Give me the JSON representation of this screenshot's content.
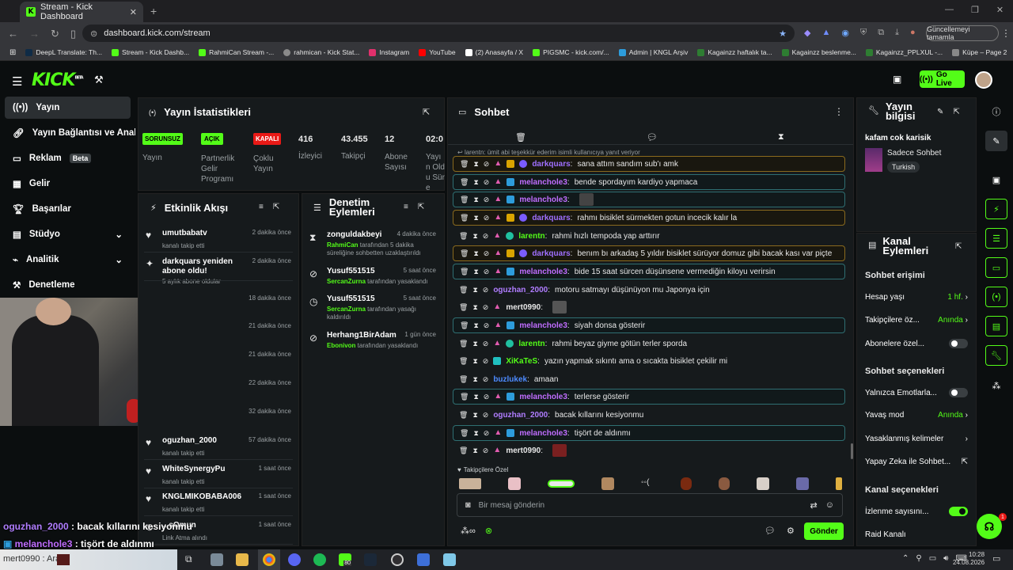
{
  "browser": {
    "tab_title": "Stream - Kick Dashboard",
    "url": "dashboard.kick.com/stream",
    "update_label": "Güncellemeyi tamamla",
    "bookmarks": [
      {
        "label": "DeepL Translate: Th...",
        "color": "#0f2b46"
      },
      {
        "label": "Stream - Kick Dashb...",
        "color": "#53fc18"
      },
      {
        "label": "RahmiCan Stream -...",
        "color": "#53fc18"
      },
      {
        "label": "rahmican - Kick Stat...",
        "color": "#8a8a8a"
      },
      {
        "label": "Instagram",
        "color": "#e1306c"
      },
      {
        "label": "YouTube",
        "color": "#ff0000"
      },
      {
        "label": "(2) Anasayfa / X",
        "color": "#ffffff"
      },
      {
        "label": "PIGSMC - kick.com/...",
        "color": "#53fc18"
      },
      {
        "label": "Admin | KNGL Arşiv",
        "color": "#2d9cdb"
      },
      {
        "label": "Kagainzz haftalık ta...",
        "color": "#2e7d32"
      },
      {
        "label": "Kagainzz beslenme...",
        "color": "#2e7d32"
      },
      {
        "label": "Kagainzz_PPLXUL -...",
        "color": "#2e7d32"
      },
      {
        "label": "Küpe – Page 2",
        "color": "#888888"
      }
    ]
  },
  "header": {
    "logo": "KICK",
    "logo_sup": "BETA",
    "go_live": "Go Live"
  },
  "sidebar": {
    "items": [
      {
        "label": "Yayın",
        "icon": "broadcast-icon"
      },
      {
        "label": "Yayın Bağlantısı ve Anahtarı",
        "icon": "link-icon"
      },
      {
        "label": "Reklam",
        "icon": "ad-icon",
        "badge": "Beta"
      },
      {
        "label": "Gelir",
        "icon": "wallet-icon"
      },
      {
        "label": "Başarılar",
        "icon": "trophy-icon"
      },
      {
        "label": "Stüdyo",
        "icon": "studio-icon"
      },
      {
        "label": "Analitik",
        "icon": "analytics-icon"
      },
      {
        "label": "Denetleme",
        "icon": "hammer-icon"
      }
    ]
  },
  "stats": {
    "title": "Yayın İstatistikleri",
    "badges": [
      {
        "value": "SORUNSUZ",
        "label": "Yayın",
        "color": "#53fc18"
      },
      {
        "value": "AÇIK",
        "label": "Partnerlik Gelir Programı",
        "color": "#53fc18"
      },
      {
        "value": "KAPALI",
        "label": "Çoklu Yayın",
        "color": "#e91916"
      }
    ],
    "numbers": [
      {
        "value": "416",
        "label": "İzleyici"
      },
      {
        "value": "43.455",
        "label": "Takipçi"
      },
      {
        "value": "12",
        "label": "Abone Sayısı"
      },
      {
        "value": "02:0",
        "label": "Yayın Oldu Süre"
      }
    ]
  },
  "activity": {
    "title": "Etkinlik Akışı",
    "items": [
      {
        "name": "umutbabatv",
        "sub": "kanalı takip etti",
        "time": "2 dakika önce"
      },
      {
        "name": "darkquars yeniden abone oldu!",
        "sub": "5 aylık abone oldular",
        "time": "2 dakika önce"
      },
      {
        "name": "",
        "sub": "",
        "time": "18 dakika önce"
      },
      {
        "name": "",
        "sub": "",
        "time": "21 dakika önce"
      },
      {
        "name": "",
        "sub": "",
        "time": "21 dakika önce"
      },
      {
        "name": "",
        "sub": "",
        "time": "22 dakika önce"
      },
      {
        "name": "",
        "sub": "",
        "time": "32 dakika önce"
      },
      {
        "name": "oguzhan_2000",
        "sub": "kanalı takip etti",
        "time": "57 dakika önce"
      },
      {
        "name": "WhiteSynergyPu",
        "sub": "kanalı takip etti",
        "time": "1 saat önce"
      },
      {
        "name": "KNGLMIKOBABA006",
        "sub": "kanalı takip etti",
        "time": "1 saat önce"
      },
      {
        "name": "...sOmun",
        "sub": "Link Atma alındı",
        "time": "1 saat önce"
      }
    ]
  },
  "moderation": {
    "title": "Denetim Eylemleri",
    "items": [
      {
        "name": "zonguldakbeyi",
        "actor": "RahmiCan",
        "rest": " tarafından 5 dakika süreliğine sohbetten uzaklaştırıldı",
        "time": "4 dakika önce"
      },
      {
        "name": "Yusuf551515",
        "actor": "SercanZurna",
        "rest": " tarafından yasaklandı",
        "time": "5 saat önce"
      },
      {
        "name": "Yusuf551515",
        "actor": "SercanZurna",
        "rest": " tarafından yasağı kaldırıldı",
        "time": "5 saat önce"
      },
      {
        "name": "Herhang1BirAdam",
        "actor": "Ebonivon",
        "rest": " tarafından yasaklandı",
        "time": "1 gün önce"
      }
    ]
  },
  "chat": {
    "title": "Sohbet",
    "reply_note": "larentn: ümit abi teşekkür ederim isimli kullanıcıya yanıt veriyor",
    "messages": [
      {
        "user": "darkquars",
        "text": "sana attım sandım sub'ı amk",
        "color": "#a070ff",
        "style": "hlg"
      },
      {
        "user": "melanchole3",
        "text": "bende spordayım kardiyo yapmaca",
        "color": "#c06dff",
        "style": "hl"
      },
      {
        "user": "melanchole3",
        "text": "",
        "color": "#c06dff",
        "style": "hl"
      },
      {
        "user": "darkquars",
        "text": "rahmı bisiklet sürmekten gotun incecik kalır la",
        "color": "#a070ff",
        "style": "hlg"
      },
      {
        "user": "larentn",
        "text": "rahmi hızlı tempoda yap arttırır",
        "color": "#53fc18",
        "style": ""
      },
      {
        "user": "darkquars",
        "text": "benım bı arkadaş 5 yıldır bisiklet sürüyor domuz gibi bacak kası var piçte",
        "color": "#a070ff",
        "style": "hlg"
      },
      {
        "user": "melanchole3",
        "text": "bide 15 saat sürcen düşünsene vermediğin kiloyu verirsin",
        "color": "#c06dff",
        "style": "hl"
      },
      {
        "user": "oguzhan_2000",
        "text": "motoru satmayı düşünüyon mu Japonya için",
        "color": "#b07dff",
        "style": ""
      },
      {
        "user": "mert0990",
        "text": "",
        "color": "#e6e6e6",
        "style": ""
      },
      {
        "user": "melanchole3",
        "text": "siyah donsa gösterir",
        "color": "#c06dff",
        "style": "hl"
      },
      {
        "user": "larentn",
        "text": "rahmi beyaz giyme götün terler sporda",
        "color": "#53fc18",
        "style": ""
      },
      {
        "user": "XiKaTeS",
        "text": "yazın yapmak sıkıntı ama o sıcakta bisiklet çekilir mi",
        "color": "#53fc18",
        "style": ""
      },
      {
        "user": "buzlukek",
        "text": "amaan",
        "color": "#4d8bff",
        "style": ""
      },
      {
        "user": "melanchole3",
        "text": "terlerse gösterir",
        "color": "#c06dff",
        "style": "hl"
      },
      {
        "user": "oguzhan_2000",
        "text": "bacak kıllarını kesiyonmu",
        "color": "#b07dff",
        "style": ""
      },
      {
        "user": "melanchole3",
        "text": "tişört de aldınmı",
        "color": "#c06dff",
        "style": "hl"
      },
      {
        "user": "mert0990",
        "text": "",
        "color": "#e6e6e6",
        "style": ""
      }
    ],
    "emote_section": "Takipçilere Özel",
    "input_placeholder": "Bir mesaj gönderin",
    "send_label": "Gönder"
  },
  "stream_info": {
    "title": "Yayın bilgisi",
    "stream_title": "kafam cok karisik",
    "category": "Sadece Sohbet",
    "language": "Turkish"
  },
  "channel_actions": {
    "title": "Kanal Eylemleri",
    "chat_access": "Sohbet erişimi",
    "account_age": {
      "label": "Hesap yaşı",
      "value": "1 hf."
    },
    "followers_only": {
      "label": "Takipçilere öz...",
      "value": "Anında"
    },
    "subscribers_only": {
      "label": "Abonelere özel...",
      "on": false
    },
    "chat_options": "Sohbet seçenekleri",
    "emote_only": {
      "label": "Yalnızca Emotlarla...",
      "on": false
    },
    "slow_mode": {
      "label": "Yavaş mod",
      "value": "Anında"
    },
    "banned_words": "Yasaklanmış kelimeler",
    "ai_chat": "Yapay Zeka ile Sohbet...",
    "channel_options": "Kanal seçenekleri",
    "view_count": {
      "label": "İzlenme sayısını...",
      "on": true
    },
    "raid": "Raid Kanalı"
  },
  "overlay": {
    "line1_user": "oguzhan_2000",
    "line1_text": " : bacak kıllarını kesiyonmu",
    "line2_user": "melanchole3",
    "line2_text": " : tişört de aldınmı",
    "line3_user": "mert0990",
    "line3_text": " : Ara"
  },
  "taskbar": {
    "time": "10:28",
    "date": "24.08.2026",
    "badge": "80",
    "help_count": "1"
  }
}
